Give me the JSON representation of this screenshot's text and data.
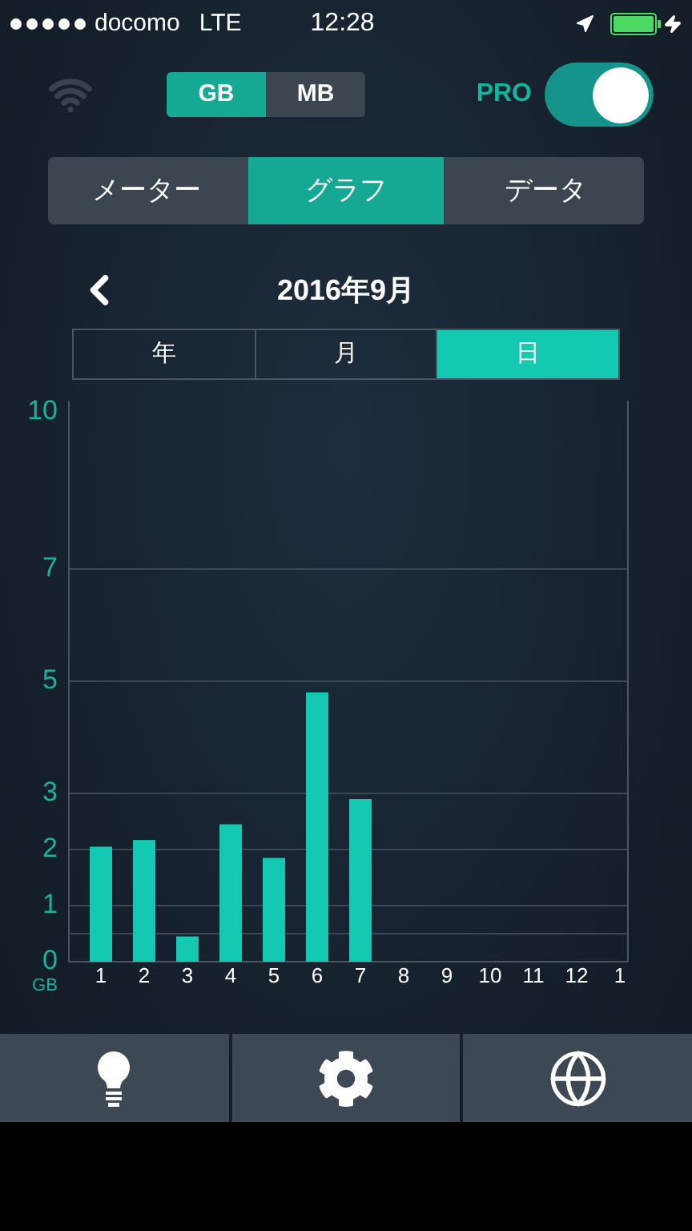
{
  "status_bar": {
    "carrier": "docomo",
    "network": "LTE",
    "time": "12:28"
  },
  "unit_toggle": [
    {
      "label": "GB",
      "selected": true
    },
    {
      "label": "MB",
      "selected": false
    }
  ],
  "pro": {
    "label": "PRO",
    "on": true
  },
  "tabs": [
    {
      "label": "メーター",
      "selected": false
    },
    {
      "label": "グラフ",
      "selected": true
    },
    {
      "label": "データ",
      "selected": false
    }
  ],
  "period": {
    "title": "2016年9月"
  },
  "range_tabs": [
    {
      "label": "年",
      "selected": false
    },
    {
      "label": "月",
      "selected": false
    },
    {
      "label": "日",
      "selected": true
    }
  ],
  "chart_data": {
    "type": "bar",
    "ylabel": "GB",
    "categories": [
      "1",
      "2",
      "3",
      "4",
      "5",
      "6",
      "7",
      "8",
      "9",
      "10",
      "11",
      "12",
      "1"
    ],
    "grid": true,
    "series": [
      {
        "color": "#14c9b1",
        "values": [
          2.05,
          2.17,
          0.45,
          2.45,
          1.85,
          4.8,
          2.9,
          0,
          0,
          0,
          0,
          0,
          0
        ]
      }
    ],
    "ylim": [
      0,
      10
    ],
    "yticks": [
      0,
      1,
      2,
      3,
      5,
      7,
      10
    ]
  }
}
